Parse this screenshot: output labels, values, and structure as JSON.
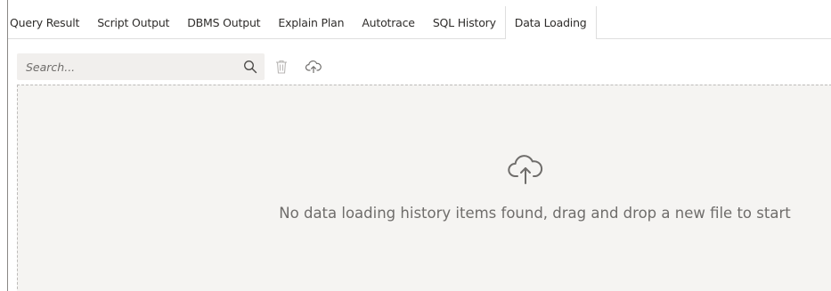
{
  "tabs": [
    {
      "label": "Query Result",
      "active": false
    },
    {
      "label": "Script Output",
      "active": false
    },
    {
      "label": "DBMS Output",
      "active": false
    },
    {
      "label": "Explain Plan",
      "active": false
    },
    {
      "label": "Autotrace",
      "active": false
    },
    {
      "label": "SQL History",
      "active": false
    },
    {
      "label": "Data Loading",
      "active": true
    }
  ],
  "toolbar": {
    "search_placeholder": "Search...",
    "search_value": "",
    "icons": [
      "search-icon",
      "trash-icon",
      "cloud-upload-icon"
    ]
  },
  "dropzone": {
    "icon": "cloud-upload-icon",
    "message": "No data loading history items found, drag and drop a new file to start"
  },
  "colors": {
    "border": "#dedede",
    "dropzone_bg": "#f5f4f2",
    "muted_text": "#6f6d6b",
    "search_bg": "#f1efed"
  }
}
